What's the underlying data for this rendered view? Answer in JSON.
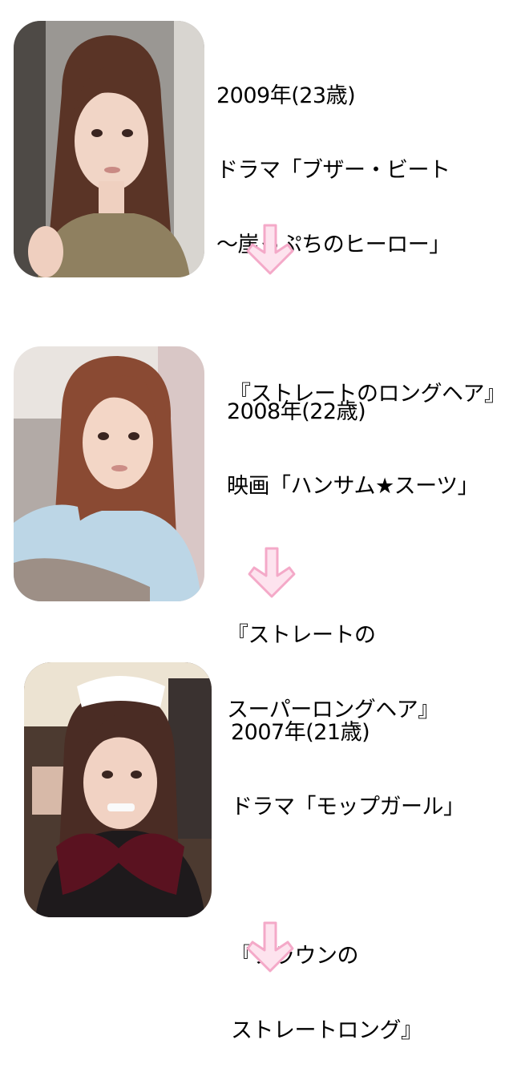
{
  "entries": [
    {
      "year": "2009年(23歳)",
      "title_line1": "ドラマ「ブザー・ビート",
      "title_line2": "～崖っぷちのヒーロー」",
      "style_line1": "『ストレートのロングヘア』",
      "style_line2": ""
    },
    {
      "year": "2008年(22歳)",
      "title_line1": "映画「ハンサム★スーツ」",
      "title_line2": "",
      "style_line1": "『ストレートの",
      "style_line2": "スーパーロングヘア』"
    },
    {
      "year": "2007年(21歳)",
      "title_line1": "ドラマ「モップガール」",
      "title_line2": "",
      "style_line1": "『ブラウンの",
      "style_line2": "ストレートロング』"
    }
  ],
  "colors": {
    "arrow_fill": "#fde3ee",
    "arrow_stroke": "#f4a9c8",
    "hair_2009": "#5a3426",
    "hair_2008": "#8a4a33",
    "hair_2007": "#4a2c24"
  }
}
